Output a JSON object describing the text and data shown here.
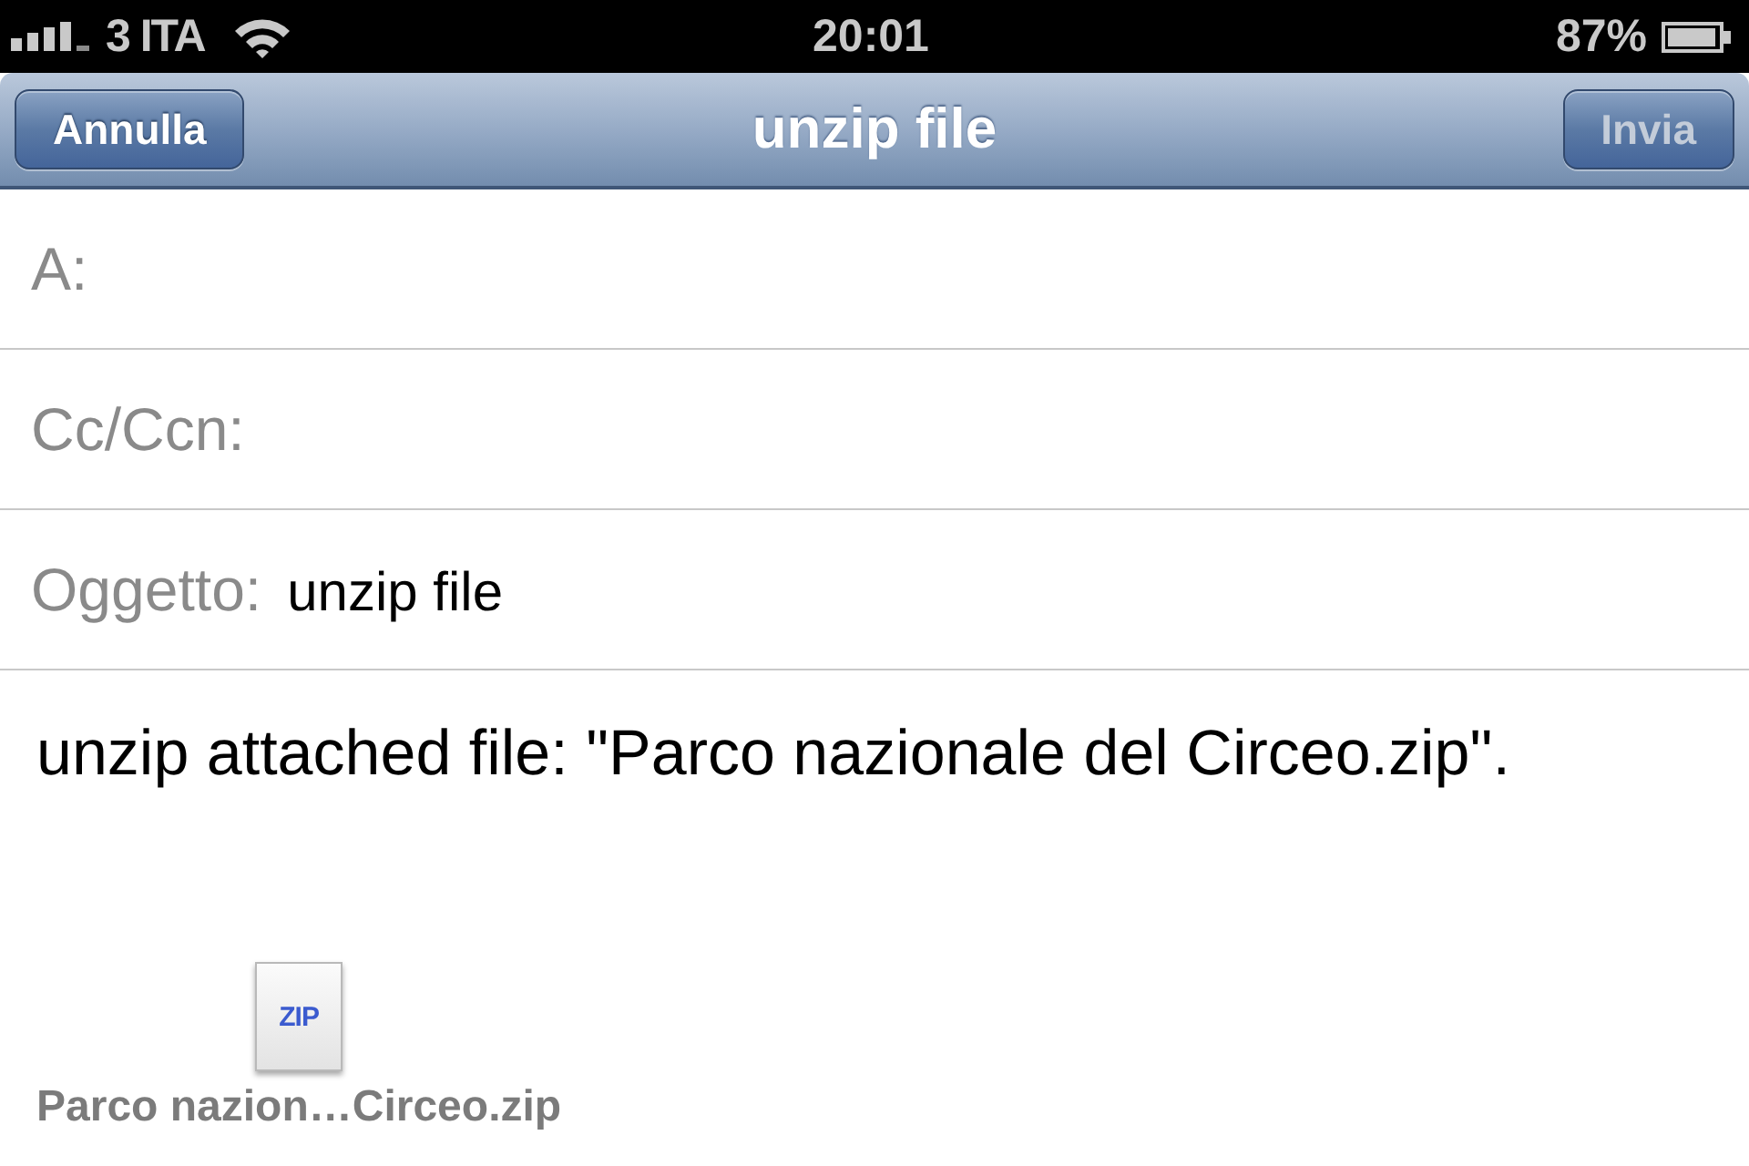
{
  "status_bar": {
    "carrier": "3 ITA",
    "time": "20:01",
    "battery": "87%"
  },
  "nav_bar": {
    "left_button": {
      "label": "Annulla",
      "disabled": false
    },
    "title": "unzip file",
    "right_button": {
      "label": "Invia",
      "disabled": true
    }
  },
  "fields": [
    {
      "label": "A:"
    },
    {
      "label": "Cc/Ccn:"
    },
    {
      "label": "Oggetto:",
      "value": "unzip file"
    }
  ],
  "body": {
    "text": "unzip attached file: \"Parco nazionale del Circeo.zip\".",
    "attachments": [
      {
        "icon_label": "ZIP",
        "name": "Parco nazion…Circeo.zip"
      }
    ]
  }
}
